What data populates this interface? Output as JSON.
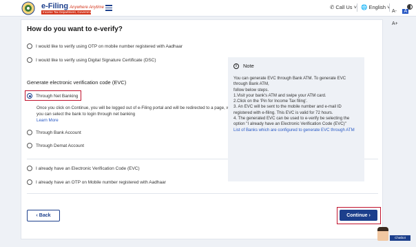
{
  "header": {
    "logo_title": "e-Filing",
    "logo_tagline": "Anywhere Anytime",
    "logo_subtitle": "Income Tax Department, Government of India",
    "call_us": "Call Us",
    "language": "English",
    "font_decrease": "A-",
    "font_normal": "A",
    "font_increase": "A+",
    "contrast_icon": "contrast-icon"
  },
  "page": {
    "title": "How do you want to e-verify?",
    "options_top": [
      {
        "label": "I would like to verify using OTP on mobile number registered with Aadhaar"
      },
      {
        "label": "I would like to verify using Digital Signature Certificate (DSC)"
      }
    ],
    "evc_section_label": "Generate electronic verification code (EVC)",
    "evc_options": [
      {
        "label": "Through Net Banking",
        "checked": true
      },
      {
        "label": "Through Bank Account",
        "checked": false
      },
      {
        "label": "Through Demat Account",
        "checked": false
      }
    ],
    "net_banking_desc": "Once you click on Continue, you will be logged out of e-Filing portal and will be redirected to a page, where you can select the bank to login through net banking",
    "learn_more": "Learn More",
    "options_bottom": [
      {
        "label": "I already have an Electronic Verification Code (EVC)"
      },
      {
        "label": "I already have an OTP on Mobile number registered with Aadhaar"
      }
    ]
  },
  "note": {
    "heading": "Note",
    "lines": [
      "You can generate EVC through Bank ATM. To generate EVC through Bank ATM,",
      "follow below steps.",
      "1.Visit your bank's ATM and swipe your ATM card.",
      "2.Click on the 'Pin for Income Tax filing'.",
      "3. An EVC will be sent to the mobile number and e-mail ID registered with e-filing. This EVC is valid for 72 hours.",
      "4. The generated EVC can be used to e-verify be selecting the option \"I already have an Electronic Verification Code (EVC)\""
    ],
    "link": "List of Banks which are configured to generate EVC through ATM"
  },
  "buttons": {
    "back": "‹ Back",
    "continue": "Continue ›"
  },
  "chatbot": {
    "label": "Chatbot"
  },
  "colors": {
    "primary": "#1c3f8c",
    "highlight": "#c0102b",
    "link": "#2758c4"
  }
}
